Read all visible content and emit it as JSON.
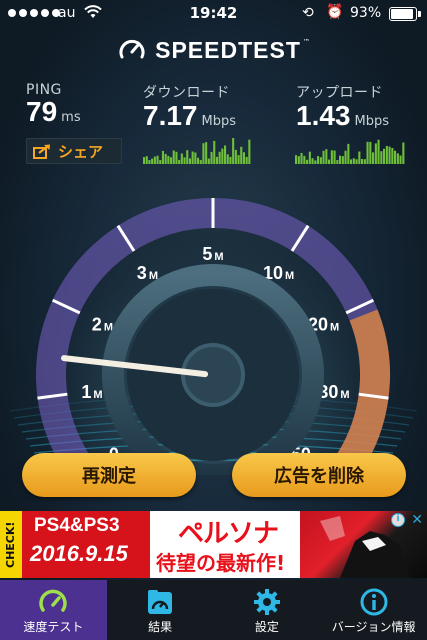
{
  "status_bar": {
    "carrier": "au",
    "time": "19:42",
    "battery_percent": "93%",
    "battery_level": 0.93
  },
  "app": {
    "logo_text": "SPEEDTEST",
    "logo_tm": "™"
  },
  "metrics": {
    "ping": {
      "label": "PING",
      "value": "79",
      "unit": "ms"
    },
    "download": {
      "label": "ダウンロード",
      "value": "7.17",
      "unit": "Mbps"
    },
    "upload": {
      "label": "アップロード",
      "value": "1.43",
      "unit": "Mbps"
    }
  },
  "share_label": "シェア",
  "gauge": {
    "labels": [
      "0",
      "1",
      "2",
      "3",
      "5",
      "10",
      "20",
      "30",
      "50"
    ],
    "unit": "M",
    "current_value_mbps": 1.43
  },
  "actions": {
    "retest": "再測定",
    "remove_ads": "広告を削除"
  },
  "ad": {
    "check": "CHECK!",
    "platforms": "PS4&PS3",
    "date": "2016.9.15",
    "title": "ペルソナ",
    "subtitle": "待望の最新作!",
    "info_icon": "i",
    "close_icon": "✕"
  },
  "tabs": [
    {
      "label": "速度テスト",
      "icon": "gauge-icon",
      "active": true
    },
    {
      "label": "結果",
      "icon": "results-icon",
      "active": false
    },
    {
      "label": "設定",
      "icon": "gear-icon",
      "active": false
    },
    {
      "label": "バージョン情報",
      "icon": "info-icon",
      "active": false
    }
  ],
  "colors": {
    "accent_orange": "#f5a623",
    "gauge_purple": "#6b4fc9",
    "spark_green": "#6fbf3a",
    "active_tab": "#4c3190"
  }
}
